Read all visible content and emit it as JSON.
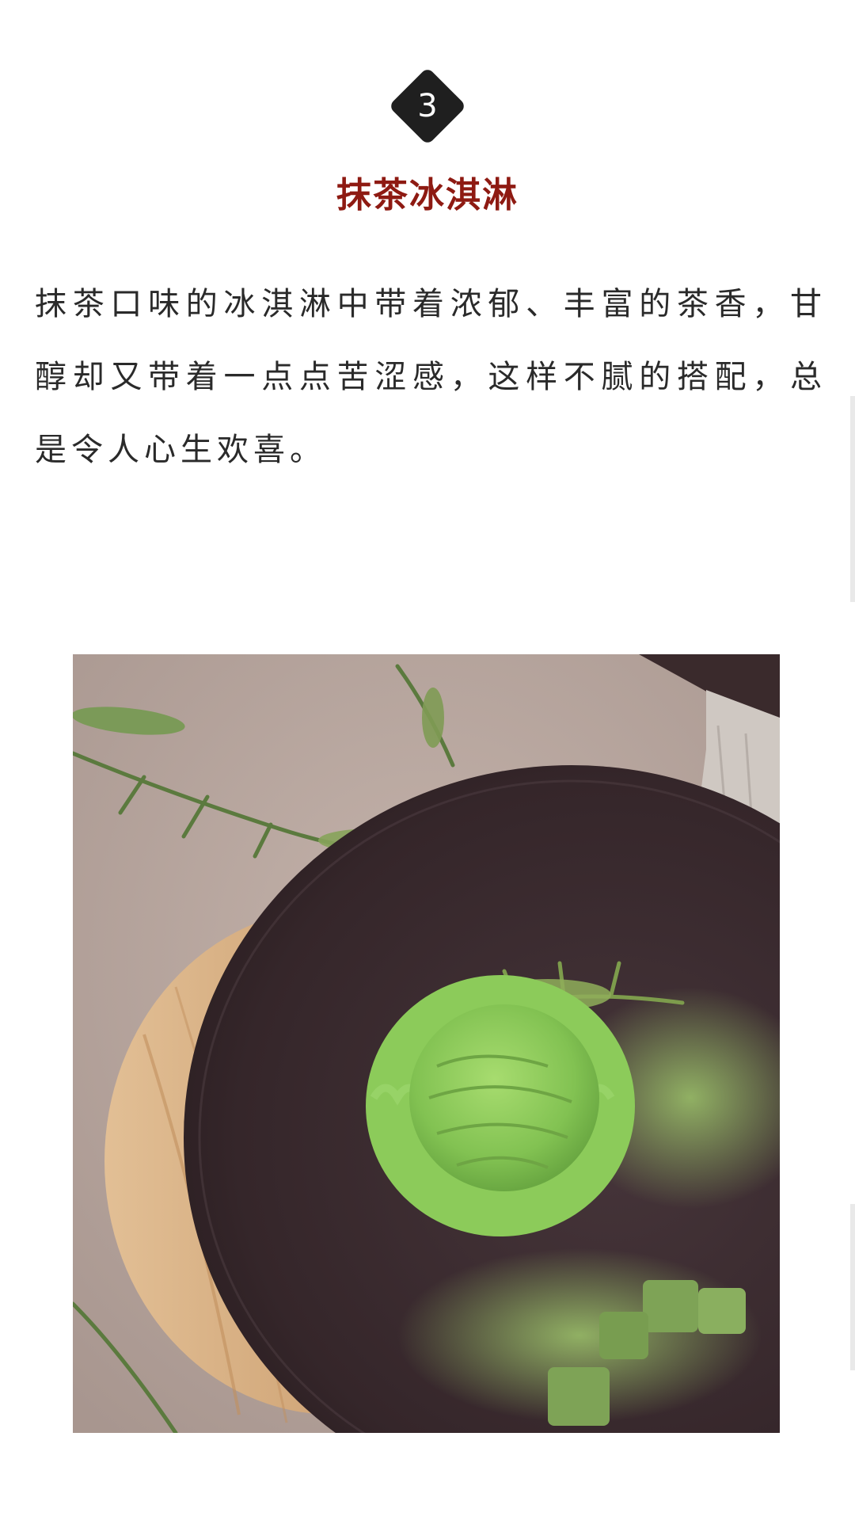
{
  "section": {
    "number": "3",
    "title": "抹茶冰淇淋",
    "paragraph": "抹茶口味的冰淇淋中带着浓郁、丰富的茶香，甘醇却又带着一点点苦涩感，这样不腻的搭配，总是令人心生欢喜。"
  },
  "photo": {
    "subject": "matcha-ice-cream-photo",
    "colors": {
      "background": "#b8a7a0",
      "plate": "#3b2b2c",
      "board": "#d9b48c",
      "ice_cream": "#86c55a",
      "matcha_powder": "#8fb060"
    }
  }
}
